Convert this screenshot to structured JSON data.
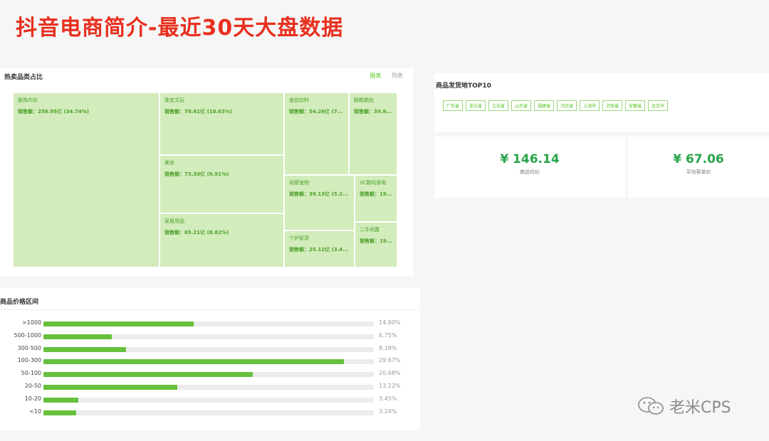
{
  "slide_title": "抖音电商简介-最近30天大盘数据",
  "treemap": {
    "title": "热卖品类占比",
    "tabs": [
      {
        "label": "图表",
        "active": true
      },
      {
        "label": "列表",
        "active": false
      }
    ],
    "cells": [
      {
        "name": "服饰内衣",
        "value": "销售额：256.95亿 (34.74%)"
      },
      {
        "name": "珠宝文玩",
        "value": "销售额：78.61亿 (10.63%)"
      },
      {
        "name": "美妆",
        "value": "销售额：73.30亿 (9.91%)"
      },
      {
        "name": "食品饮料",
        "value": "销售额：54.26亿 (7..."
      },
      {
        "name": "鞋靴箱包",
        "value": "销售额：39.9..."
      },
      {
        "name": "母婴宠物",
        "value": "销售额：39.13亿 (5.2..."
      },
      {
        "name": "3C数码家电",
        "value": "销售额：19..."
      },
      {
        "name": "家居用品",
        "value": "销售额：65.21亿 (8.82%)"
      },
      {
        "name": "个护家清",
        "value": "销售额：25.12亿 (3.4..."
      },
      {
        "name": "二手闲置",
        "value": "销售额：19..."
      }
    ]
  },
  "origin": {
    "title": "商品发货地TOP10",
    "tags": [
      "广东省",
      "浙江省",
      "江苏省",
      "山东省",
      "福建省",
      "河北省",
      "上海市",
      "河南省",
      "安徽省",
      "北京市"
    ]
  },
  "stats": [
    {
      "value": "¥ 146.14",
      "label": "商品均价"
    },
    {
      "value": "¥ 67.06",
      "label": "平均客单价"
    }
  ],
  "price": {
    "title": "商品价格区间",
    "rows": [
      {
        "label": ">1000",
        "pct_text": "14.80%",
        "pct": 14.8
      },
      {
        "label": "500-1000",
        "pct_text": "6.75%",
        "pct": 6.75
      },
      {
        "label": "300-500",
        "pct_text": "8.18%",
        "pct": 8.18
      },
      {
        "label": "100-300",
        "pct_text": "29.67%",
        "pct": 29.67
      },
      {
        "label": "50-100",
        "pct_text": "20.68%",
        "pct": 20.68
      },
      {
        "label": "20-50",
        "pct_text": "13.22%",
        "pct": 13.22
      },
      {
        "label": "10-20",
        "pct_text": "3.45%",
        "pct": 3.45
      },
      {
        "label": "<10",
        "pct_text": "3.24%",
        "pct": 3.24
      }
    ],
    "max_pct": 29.67
  },
  "watermark": {
    "text": "老米CPS",
    "icon": "wechat-icon"
  },
  "colors": {
    "title_red": "#e8301f",
    "green": "#52c41a",
    "bar_green": "#65c03c",
    "cell_green": "#d2ecbb",
    "stat_green": "#27a54a"
  }
}
